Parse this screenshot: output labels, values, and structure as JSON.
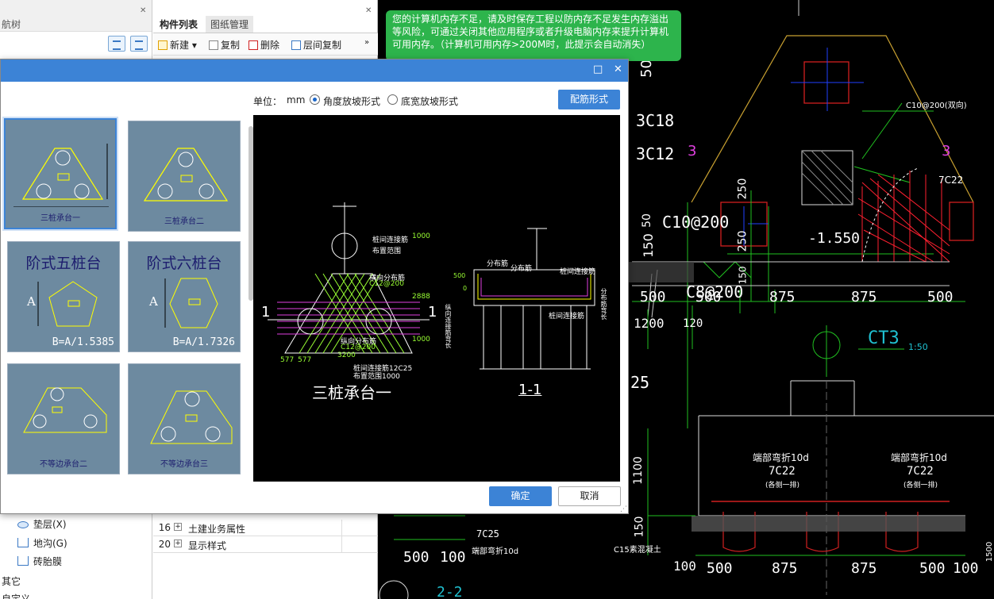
{
  "nav": {
    "header": "航树",
    "items": [
      {
        "label": "垫层(X)"
      },
      {
        "label": "地沟(G)"
      },
      {
        "label": "砖胎膜"
      }
    ],
    "other": "其它",
    "custom": "自定义"
  },
  "comp": {
    "tabs": [
      "构件列表",
      "图纸管理"
    ],
    "toolbar": {
      "new": "新建",
      "copy": "复制",
      "delete": "删除",
      "floor_copy": "层间复制"
    },
    "props": [
      {
        "num": "16",
        "label": "土建业务属性"
      },
      {
        "num": "20",
        "label": "显示样式"
      }
    ]
  },
  "tooltip": "您的计算机内存不足，请及时保存工程以防内存不足发生内存溢出等风险，可通过关闭其他应用程序或者升级电脑内存来提升计算机可用内存。（计算机可用内存>200M时，此提示会自动消失）",
  "dialog": {
    "unit_label": "单位：",
    "unit_value": "mm",
    "radio1": "角度放坡形式",
    "radio2": "底宽放坡形式",
    "rebar_btn": "配筋形式",
    "ok": "确定",
    "cancel": "取消",
    "thumbs": [
      {
        "caption": "三桩承台一"
      },
      {
        "caption": "三桩承台二"
      },
      {
        "caption": "阶式五桩台",
        "formula": "B=A/1.5385"
      },
      {
        "caption": "阶式六桩台",
        "formula": "B=A/1.7326"
      },
      {
        "caption": "不等边承台二"
      },
      {
        "caption": "不等边承台三"
      }
    ],
    "preview": {
      "title": "三桩承台一",
      "section": "1-1",
      "mark_left": "1",
      "mark_right": "1",
      "labels": {
        "edge": "桩间连接筋",
        "range": "布置范围",
        "dist": "横向分布筋",
        "dist_val": "C12@200",
        "vert": "纵向分布筋",
        "vert_val": "C12@200",
        "conn": "桩间连接筋12C25",
        "conn_range": "布置范围1000",
        "d1": "577",
        "d2": "577",
        "d3": "3200",
        "h1": "2888",
        "h2": "1000",
        "h3": "1000",
        "s_dist": "分布筋",
        "s_dist2": "分布筋",
        "s_conn": "桩间连接筋",
        "s_conn2": "桩间连接筋",
        "s_500": "500",
        "s_0": "0",
        "s_side": "纵向连接筋弯长",
        "s_side2": "分布筋弯长"
      }
    }
  },
  "cad": {
    "t1": "3C18",
    "t2": "3C12",
    "t3": "3",
    "t4": "3",
    "t5": "C10@200(双向)",
    "t6": "7C22",
    "t7": "250",
    "t8": "250",
    "t9": "-1.550",
    "t10": "C10@200",
    "t11": "C8@200",
    "t12": "50",
    "t13": "500",
    "t14": "875",
    "t15": "875",
    "t16": "500",
    "t17": "1200",
    "t18": "120",
    "t19": "CT3",
    "t20": "1:50",
    "t21": "25",
    "t22": "端部弯折10d",
    "t23": "7C22",
    "t24": "(各侧一排)",
    "t25": "端部弯折10d",
    "t26": "7C22",
    "t27": "(各侧一排)",
    "t28": "1100",
    "t29": "150",
    "t30": "7C25",
    "t31": "端部弯折10d",
    "t32": "C15素混凝土",
    "t33": "100",
    "t34": "500",
    "t35": "875",
    "t36": "875",
    "t37": "500",
    "t38": "100",
    "t39": "500",
    "t40": "100",
    "t41": "2-2",
    "t42": "150",
    "t43": "150",
    "t44": "50",
    "t45": "500",
    "t46": "1500"
  }
}
